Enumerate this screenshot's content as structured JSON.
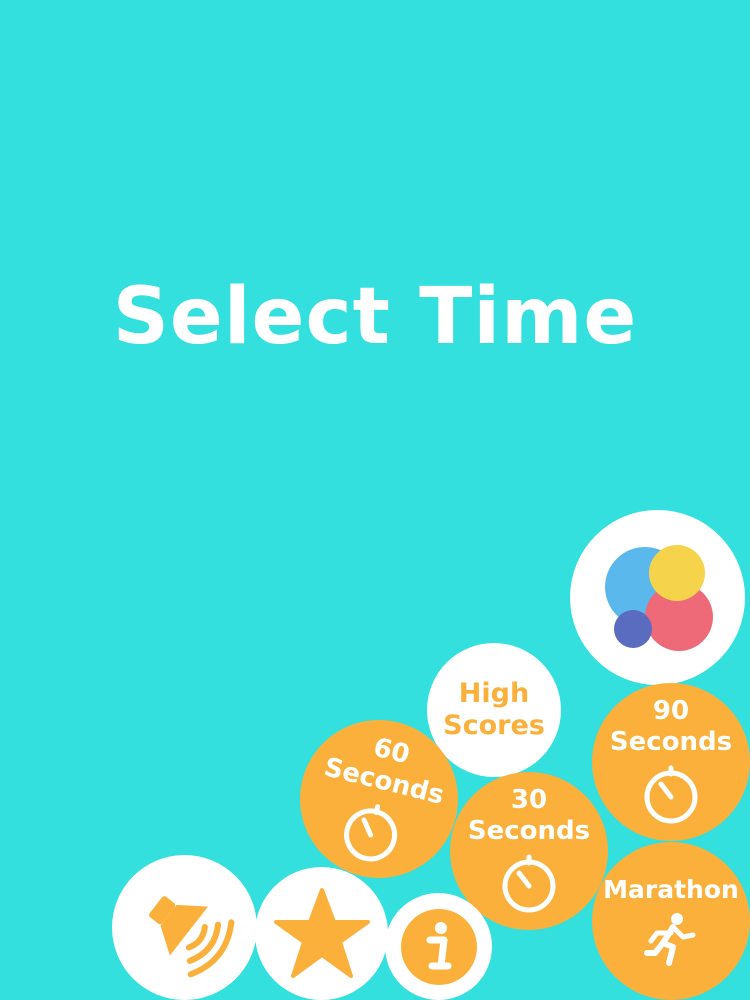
{
  "screen": {
    "title": "Select Time"
  },
  "buttons": {
    "high_scores": {
      "line1": "High",
      "line2": "Scores"
    },
    "sixty": {
      "line1": "60",
      "line2": "Seconds"
    },
    "thirty": {
      "line1": "30",
      "line2": "Seconds"
    },
    "ninety": {
      "line1": "90",
      "line2": "Seconds"
    },
    "marathon": {
      "label": "Marathon"
    }
  },
  "icons": {
    "sound": "speaker-icon",
    "rate": "star-icon",
    "info": "info-icon",
    "game_center": "game-center-icon",
    "timer": "stopwatch-icon",
    "marathon": "running-person-icon"
  },
  "colors": {
    "background": "#33e0dd",
    "accent": "#fbb03b",
    "white": "#ffffff",
    "gc_blue": "#5bb8ec",
    "gc_yellow": "#f5d34a",
    "gc_red": "#ee6a78",
    "gc_purple": "#5a6cc0"
  }
}
